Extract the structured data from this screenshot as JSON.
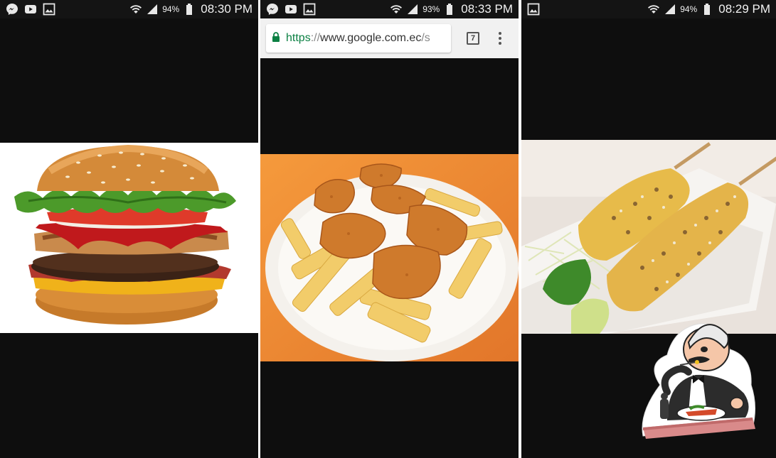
{
  "panels": [
    {
      "status": {
        "battery": "94%",
        "time": "08:30 PM"
      },
      "notification_icons": [
        "messenger-icon",
        "youtube-icon",
        "gallery-icon"
      ],
      "image": {
        "subject": "burger"
      }
    },
    {
      "status": {
        "battery": "93%",
        "time": "08:33 PM"
      },
      "notification_icons": [
        "messenger-icon",
        "youtube-icon",
        "gallery-icon"
      ],
      "browser": {
        "url_scheme": "https",
        "url_sep": "://",
        "url_host": "www.google.com.ec",
        "url_rest": "/s",
        "tab_count": "7"
      },
      "image": {
        "subject": "chicken-nuggets-and-fries"
      }
    },
    {
      "status": {
        "battery": "94%",
        "time": "08:29 PM"
      },
      "notification_icons": [
        "gallery-icon"
      ],
      "image": {
        "subject": "grilled-corn"
      }
    }
  ],
  "colors": {
    "background": "#0e0e0e",
    "status_bar": "#141414",
    "url_secure": "#0b8043",
    "chrome_toolbar": "#f1f1f1"
  }
}
